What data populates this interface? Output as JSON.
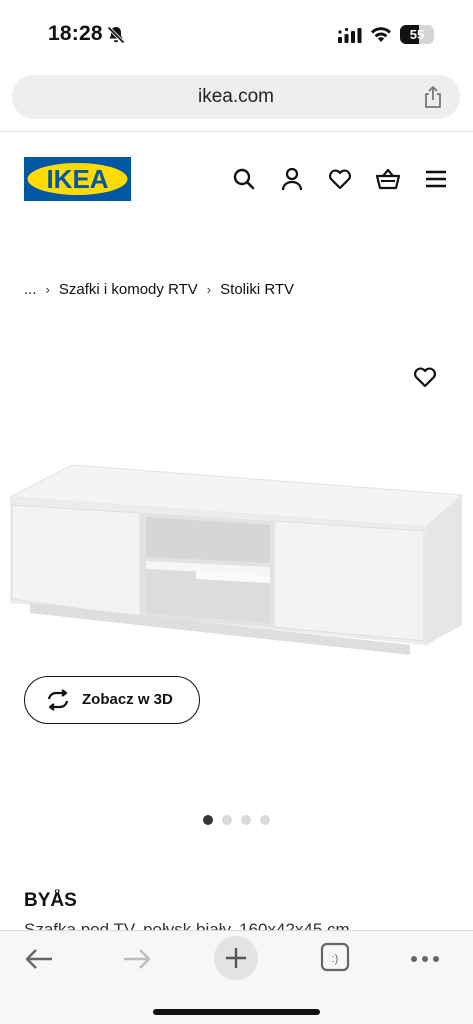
{
  "status_bar": {
    "time": "18:28",
    "battery_level": "55"
  },
  "browser": {
    "url": "ikea.com"
  },
  "header": {
    "logo_text": "IKEA",
    "icons": [
      "search-icon",
      "account-icon",
      "heart-icon",
      "basket-icon",
      "menu-icon"
    ]
  },
  "breadcrumb": {
    "ellipsis": "...",
    "items": [
      "Szafki i komody RTV",
      "Stoliki RTV"
    ]
  },
  "product": {
    "view_3d_label": "Zobacz w 3D",
    "image_count": 4,
    "active_image": 1,
    "name": "BYÅS",
    "description": "Szafka pod TV, połysk biały, 160x42x45 cm"
  },
  "colors": {
    "ikea_blue": "#0058a3",
    "ikea_yellow": "#ffdb00"
  }
}
